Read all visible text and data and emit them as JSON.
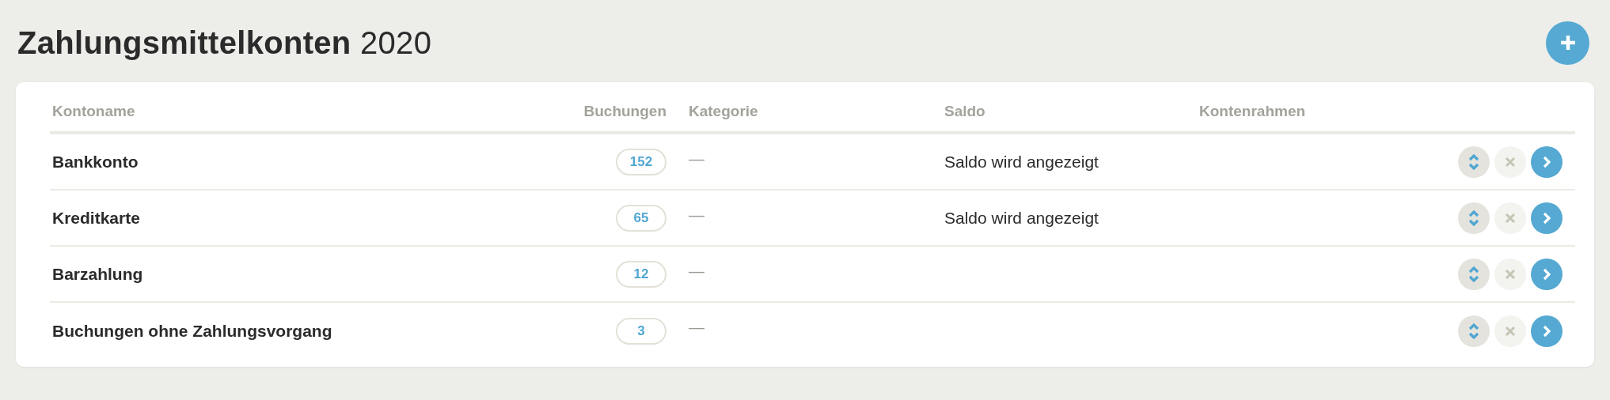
{
  "title": {
    "main": "Zahlungsmittelkonten",
    "year": "2020"
  },
  "table": {
    "columns": [
      "Kontoname",
      "Buchungen",
      "Kategorie",
      "Saldo",
      "Kontenrahmen"
    ],
    "rows": [
      {
        "name": "Bankkonto",
        "bookings": "152",
        "category": "—",
        "balance": "Saldo wird angezeigt"
      },
      {
        "name": "Kreditkarte",
        "bookings": "65",
        "category": "—",
        "balance": "Saldo wird angezeigt"
      },
      {
        "name": "Barzahlung",
        "bookings": "12",
        "category": "—"
      },
      {
        "name": "Buchungen ohne Zahlungsvorgang",
        "bookings": "3",
        "category": "—"
      }
    ]
  }
}
